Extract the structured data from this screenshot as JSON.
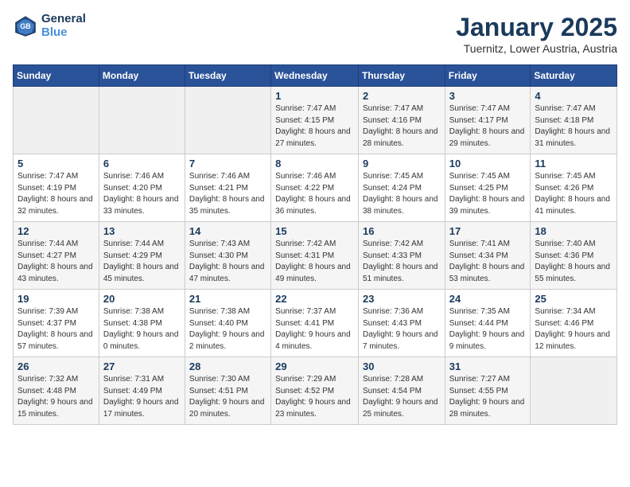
{
  "header": {
    "logo_line1": "General",
    "logo_line2": "Blue",
    "month": "January 2025",
    "location": "Tuernitz, Lower Austria, Austria"
  },
  "weekdays": [
    "Sunday",
    "Monday",
    "Tuesday",
    "Wednesday",
    "Thursday",
    "Friday",
    "Saturday"
  ],
  "weeks": [
    [
      {
        "day": "",
        "info": ""
      },
      {
        "day": "",
        "info": ""
      },
      {
        "day": "",
        "info": ""
      },
      {
        "day": "1",
        "info": "Sunrise: 7:47 AM\nSunset: 4:15 PM\nDaylight: 8 hours and 27 minutes."
      },
      {
        "day": "2",
        "info": "Sunrise: 7:47 AM\nSunset: 4:16 PM\nDaylight: 8 hours and 28 minutes."
      },
      {
        "day": "3",
        "info": "Sunrise: 7:47 AM\nSunset: 4:17 PM\nDaylight: 8 hours and 29 minutes."
      },
      {
        "day": "4",
        "info": "Sunrise: 7:47 AM\nSunset: 4:18 PM\nDaylight: 8 hours and 31 minutes."
      }
    ],
    [
      {
        "day": "5",
        "info": "Sunrise: 7:47 AM\nSunset: 4:19 PM\nDaylight: 8 hours and 32 minutes."
      },
      {
        "day": "6",
        "info": "Sunrise: 7:46 AM\nSunset: 4:20 PM\nDaylight: 8 hours and 33 minutes."
      },
      {
        "day": "7",
        "info": "Sunrise: 7:46 AM\nSunset: 4:21 PM\nDaylight: 8 hours and 35 minutes."
      },
      {
        "day": "8",
        "info": "Sunrise: 7:46 AM\nSunset: 4:22 PM\nDaylight: 8 hours and 36 minutes."
      },
      {
        "day": "9",
        "info": "Sunrise: 7:45 AM\nSunset: 4:24 PM\nDaylight: 8 hours and 38 minutes."
      },
      {
        "day": "10",
        "info": "Sunrise: 7:45 AM\nSunset: 4:25 PM\nDaylight: 8 hours and 39 minutes."
      },
      {
        "day": "11",
        "info": "Sunrise: 7:45 AM\nSunset: 4:26 PM\nDaylight: 8 hours and 41 minutes."
      }
    ],
    [
      {
        "day": "12",
        "info": "Sunrise: 7:44 AM\nSunset: 4:27 PM\nDaylight: 8 hours and 43 minutes."
      },
      {
        "day": "13",
        "info": "Sunrise: 7:44 AM\nSunset: 4:29 PM\nDaylight: 8 hours and 45 minutes."
      },
      {
        "day": "14",
        "info": "Sunrise: 7:43 AM\nSunset: 4:30 PM\nDaylight: 8 hours and 47 minutes."
      },
      {
        "day": "15",
        "info": "Sunrise: 7:42 AM\nSunset: 4:31 PM\nDaylight: 8 hours and 49 minutes."
      },
      {
        "day": "16",
        "info": "Sunrise: 7:42 AM\nSunset: 4:33 PM\nDaylight: 8 hours and 51 minutes."
      },
      {
        "day": "17",
        "info": "Sunrise: 7:41 AM\nSunset: 4:34 PM\nDaylight: 8 hours and 53 minutes."
      },
      {
        "day": "18",
        "info": "Sunrise: 7:40 AM\nSunset: 4:36 PM\nDaylight: 8 hours and 55 minutes."
      }
    ],
    [
      {
        "day": "19",
        "info": "Sunrise: 7:39 AM\nSunset: 4:37 PM\nDaylight: 8 hours and 57 minutes."
      },
      {
        "day": "20",
        "info": "Sunrise: 7:38 AM\nSunset: 4:38 PM\nDaylight: 9 hours and 0 minutes."
      },
      {
        "day": "21",
        "info": "Sunrise: 7:38 AM\nSunset: 4:40 PM\nDaylight: 9 hours and 2 minutes."
      },
      {
        "day": "22",
        "info": "Sunrise: 7:37 AM\nSunset: 4:41 PM\nDaylight: 9 hours and 4 minutes."
      },
      {
        "day": "23",
        "info": "Sunrise: 7:36 AM\nSunset: 4:43 PM\nDaylight: 9 hours and 7 minutes."
      },
      {
        "day": "24",
        "info": "Sunrise: 7:35 AM\nSunset: 4:44 PM\nDaylight: 9 hours and 9 minutes."
      },
      {
        "day": "25",
        "info": "Sunrise: 7:34 AM\nSunset: 4:46 PM\nDaylight: 9 hours and 12 minutes."
      }
    ],
    [
      {
        "day": "26",
        "info": "Sunrise: 7:32 AM\nSunset: 4:48 PM\nDaylight: 9 hours and 15 minutes."
      },
      {
        "day": "27",
        "info": "Sunrise: 7:31 AM\nSunset: 4:49 PM\nDaylight: 9 hours and 17 minutes."
      },
      {
        "day": "28",
        "info": "Sunrise: 7:30 AM\nSunset: 4:51 PM\nDaylight: 9 hours and 20 minutes."
      },
      {
        "day": "29",
        "info": "Sunrise: 7:29 AM\nSunset: 4:52 PM\nDaylight: 9 hours and 23 minutes."
      },
      {
        "day": "30",
        "info": "Sunrise: 7:28 AM\nSunset: 4:54 PM\nDaylight: 9 hours and 25 minutes."
      },
      {
        "day": "31",
        "info": "Sunrise: 7:27 AM\nSunset: 4:55 PM\nDaylight: 9 hours and 28 minutes."
      },
      {
        "day": "",
        "info": ""
      }
    ]
  ]
}
